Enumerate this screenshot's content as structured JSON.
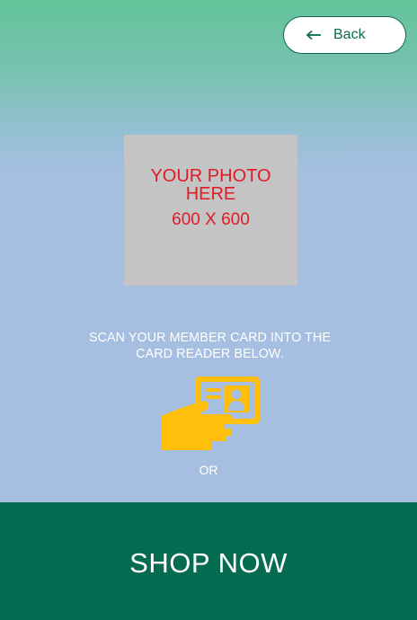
{
  "header": {
    "back_label": "Back",
    "back_icon": "arrow-left-icon"
  },
  "photo": {
    "placeholder_line1": "YOUR PHOTO HERE",
    "placeholder_line2": "600 X 600"
  },
  "instructions": {
    "scan_text": "SCAN YOUR MEMBER CARD INTO THE CARD READER BELOW.",
    "icon": "member-card-scan-icon",
    "or_text": "OR"
  },
  "footer": {
    "shop_label": "SHOP NOW"
  },
  "colors": {
    "brand_green": "#066c51",
    "accent_yellow": "#ffbf0a",
    "placeholder_red": "#e01a26",
    "gradient_top": "#62c398",
    "gradient_bottom": "#a6bfe0"
  }
}
